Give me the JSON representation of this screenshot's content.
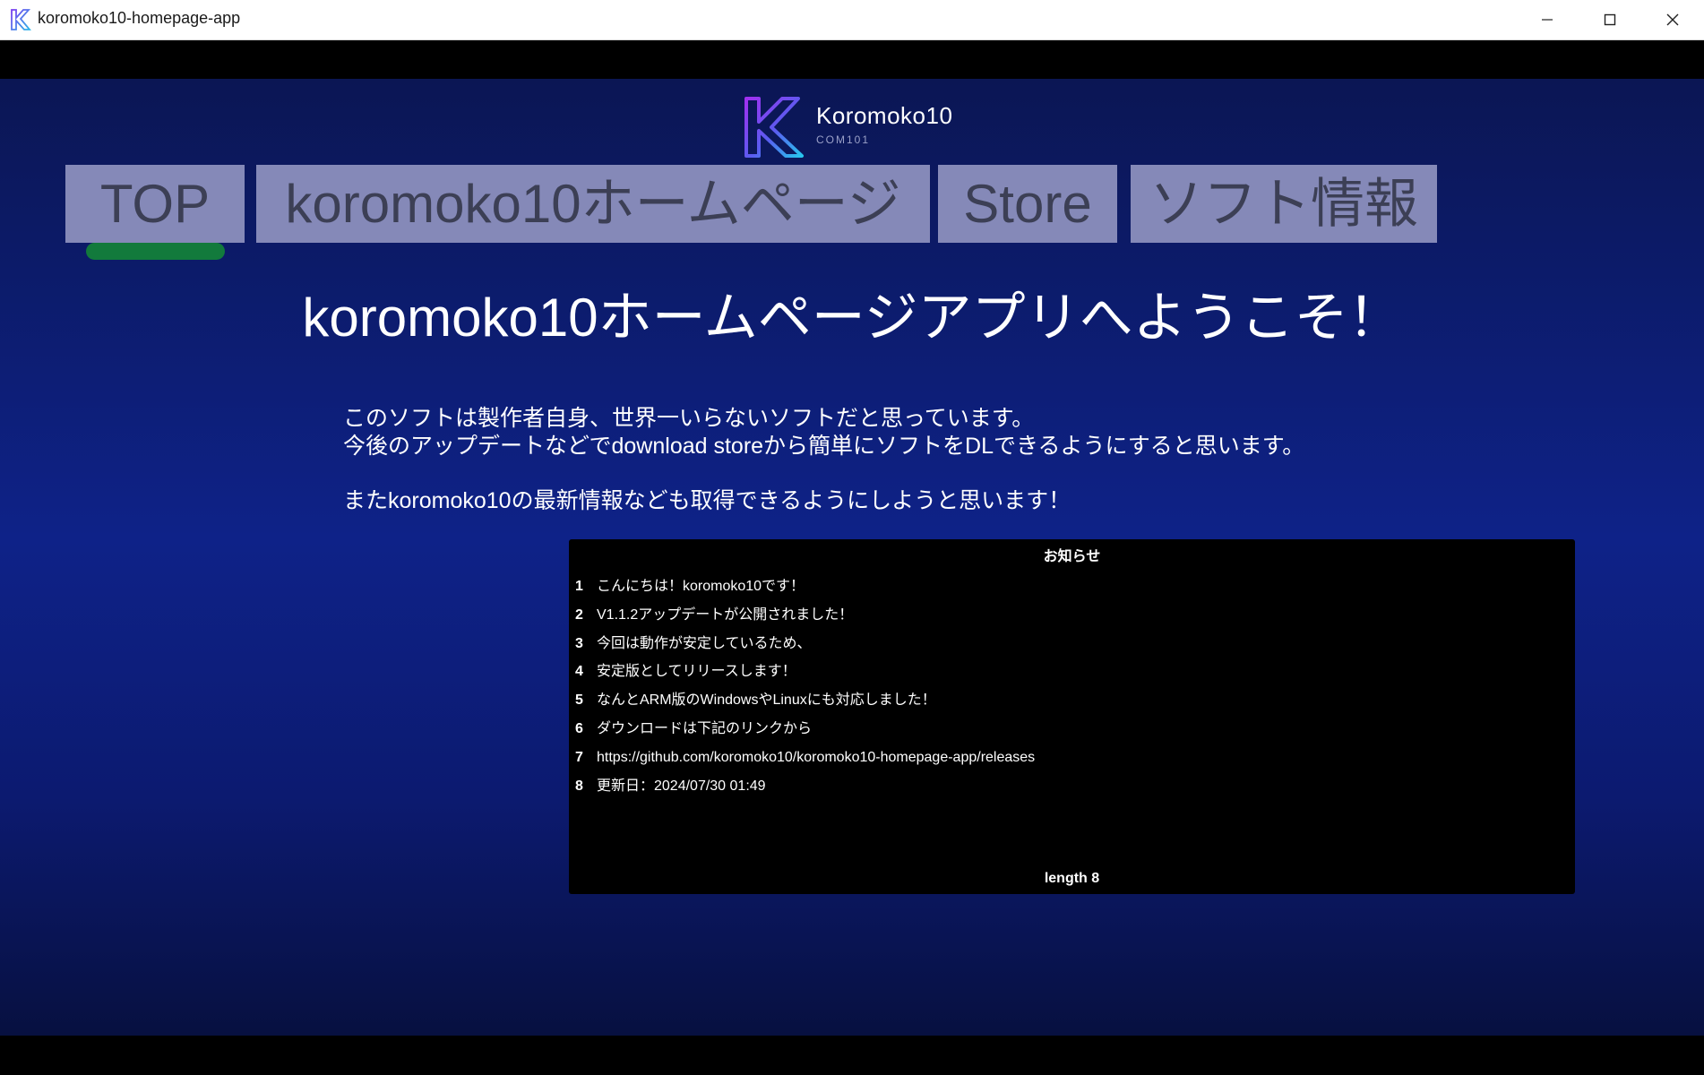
{
  "window": {
    "title": "koromoko10-homepage-app",
    "app_icon": "k-logo-icon",
    "controls": [
      "minimize-icon",
      "maximize-icon",
      "close-icon"
    ]
  },
  "logo": {
    "name": "Koromoko10",
    "subtitle": "COM101"
  },
  "nav": {
    "items": [
      {
        "label": "TOP",
        "active": true
      },
      {
        "label": "koromoko10ホームページ",
        "active": false
      },
      {
        "label": "Store",
        "active": false
      },
      {
        "label": "ソフト情報",
        "active": false
      }
    ]
  },
  "main": {
    "welcome": "koromoko10ホームページアプリへようこそ！",
    "intro": [
      "このソフトは製作者自身、世界一いらないソフトだと思っています。",
      "今後のアップデートなどでdownload storeから簡単にソフトをDLできるようにすると思います。",
      "またkoromoko10の最新情報なども取得できるようにしようと思います！"
    ]
  },
  "news": {
    "title": "お知らせ",
    "items": [
      {
        "num": "1",
        "text": "こんにちは！koromoko10です！"
      },
      {
        "num": "2",
        "text": "V1.1.2アップデートが公開されました！"
      },
      {
        "num": "3",
        "text": "今回は動作が安定しているため、"
      },
      {
        "num": "4",
        "text": "安定版としてリリースします！"
      },
      {
        "num": "5",
        "text": "なんとARM版のWindowsやLinuxにも対応しました！"
      },
      {
        "num": "6",
        "text": "ダウンロードは下記のリンクから"
      },
      {
        "num": "7",
        "text": "https://github.com/koromoko10/koromoko10-homepage-app/releases"
      },
      {
        "num": "8",
        "text": "更新日：2024/07/30 01:49"
      }
    ],
    "footer": "length 8"
  },
  "colors": {
    "nav_bg": "#8589b8",
    "nav_text": "#3c3f55",
    "active_indicator": "#127a3c",
    "page_bg": "#0e2288"
  }
}
